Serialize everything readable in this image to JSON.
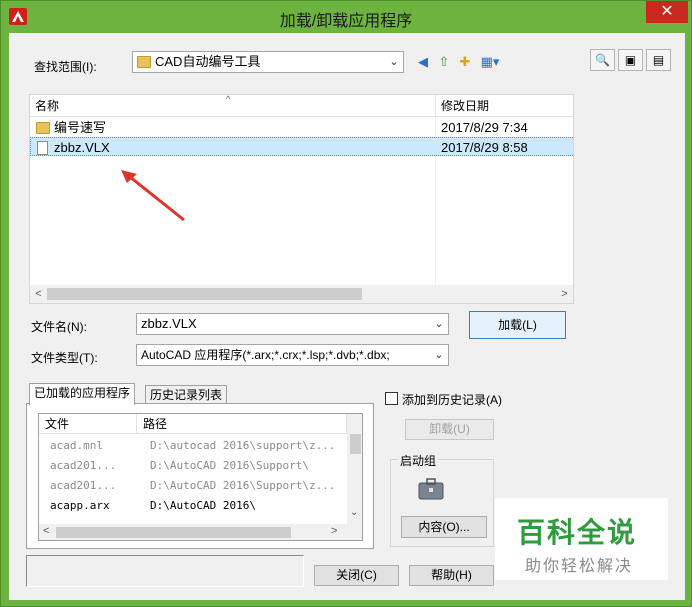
{
  "window": {
    "title": "加载/卸载应用程序",
    "close_glyph": "✕"
  },
  "lookin": {
    "label": "查找范围(I):",
    "value": "CAD自动编号工具"
  },
  "file_list": {
    "headers": [
      "名称",
      "修改日期"
    ],
    "rows": [
      {
        "name": "编号速写",
        "date": "2017/8/29 7:34",
        "type": "folder"
      },
      {
        "name": "zbbz.VLX",
        "date": "2017/8/29 8:58",
        "type": "file",
        "selected": true
      }
    ]
  },
  "filename": {
    "label": "文件名(N):",
    "value": "zbbz.VLX"
  },
  "filetype": {
    "label": "文件类型(T):",
    "value": "AutoCAD 应用程序(*.arx;*.crx;*.lsp;*.dvb;*.dbx;"
  },
  "buttons": {
    "load": "加载(L)",
    "unload": "卸载(U)",
    "contents": "内容(O)...",
    "close": "关闭(C)",
    "help": "帮助(H)"
  },
  "tabs": [
    "已加载的应用程序",
    "历史记录列表"
  ],
  "app_list": {
    "headers": [
      "文件",
      "路径"
    ],
    "rows": [
      {
        "file": "acad.mnl",
        "path": "D:\\autocad 2016\\support\\z...",
        "dim": true
      },
      {
        "file": "acad201...",
        "path": "D:\\AutoCAD 2016\\Support\\",
        "dim": true
      },
      {
        "file": "acad201...",
        "path": "D:\\AutoCAD 2016\\Support\\z...",
        "dim": true
      },
      {
        "file": "acapp.arx",
        "path": "D:\\AutoCAD 2016\\",
        "dim": false
      }
    ]
  },
  "history_checkbox": "添加到历史记录(A)",
  "startup_group": "启动组",
  "watermark": {
    "main": "百科全说",
    "sub": "助你轻松解决"
  },
  "colors": {
    "title_bar": "#6db33f",
    "close_button": "#c7291f",
    "selection": "#cce8ff",
    "watermark_green": "#2e9c3c"
  }
}
